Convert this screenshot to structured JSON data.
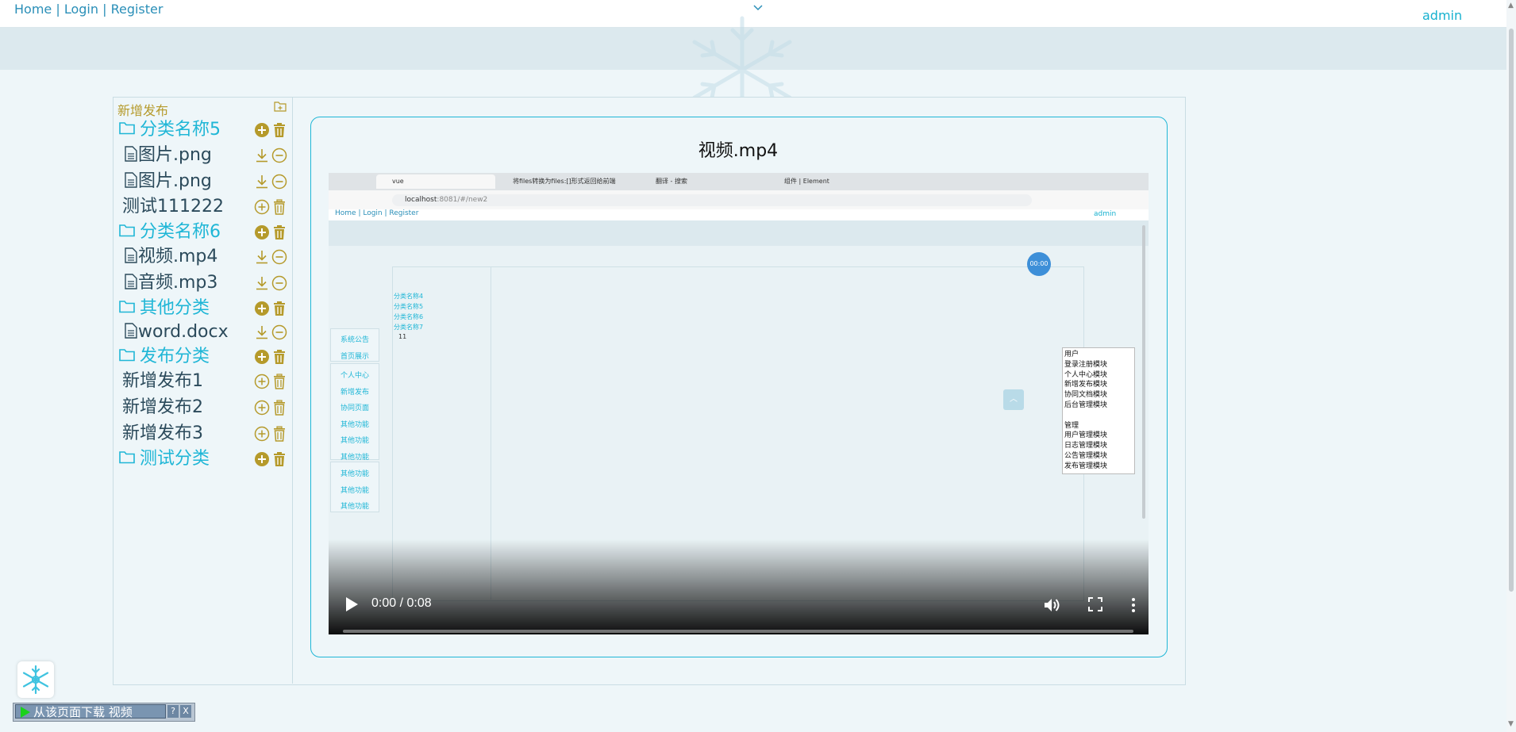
{
  "topbar": {
    "nav": [
      "Home",
      "Login",
      "Register"
    ],
    "user": "admin"
  },
  "sidebar": {
    "header": "新增发布",
    "items": [
      {
        "type": "folder",
        "label": "分类名称5",
        "actions": [
          "add",
          "delete"
        ]
      },
      {
        "type": "file",
        "label": "图片.png",
        "actions": [
          "download",
          "remove"
        ]
      },
      {
        "type": "file",
        "label": "图片.png",
        "actions": [
          "download",
          "remove"
        ]
      },
      {
        "type": "plain",
        "label": "测试111222",
        "actions": [
          "add",
          "delete"
        ]
      },
      {
        "type": "folder",
        "label": "分类名称6",
        "actions": [
          "add",
          "delete"
        ]
      },
      {
        "type": "file",
        "label": "视频.mp4",
        "actions": [
          "download",
          "remove"
        ]
      },
      {
        "type": "file",
        "label": "音频.mp3",
        "actions": [
          "download",
          "remove"
        ]
      },
      {
        "type": "folder",
        "label": "其他分类",
        "actions": [
          "add",
          "delete"
        ]
      },
      {
        "type": "file",
        "label": "word.docx",
        "actions": [
          "download",
          "remove"
        ]
      },
      {
        "type": "folder",
        "label": "发布分类",
        "actions": [
          "add",
          "delete"
        ]
      },
      {
        "type": "plain",
        "label": "新增发布1",
        "actions": [
          "add",
          "delete"
        ]
      },
      {
        "type": "plain",
        "label": "新增发布2",
        "actions": [
          "add",
          "delete"
        ]
      },
      {
        "type": "plain",
        "label": "新增发布3",
        "actions": [
          "add",
          "delete"
        ]
      },
      {
        "type": "folder",
        "label": "测试分类",
        "actions": [
          "add",
          "delete"
        ]
      }
    ]
  },
  "video": {
    "title": "视频.mp4",
    "time": "0:00 / 0:08",
    "progress": 0,
    "frame": {
      "tabs": [
        "vue",
        "将files转换为files:[]形式返回给前端",
        "翻译 - 搜索",
        "组件 | Element"
      ],
      "url_host": "localhost",
      "url_rest": ":8081/#/new2",
      "nav": "Home | Login | Register",
      "user": "admin",
      "timer": "00:00",
      "mini_tree": [
        "分类名称4",
        "分类名称5",
        "分类名称6",
        "分类名称7",
        "11"
      ],
      "left_menu_1": [
        "系统公告",
        "首页展示"
      ],
      "left_menu_2": [
        "个人中心",
        "新增发布",
        "协同页面",
        "其他功能",
        "其他功能",
        "其他功能"
      ],
      "left_menu_3": [
        "其他功能",
        "其他功能",
        "其他功能"
      ],
      "context_menu": [
        "用户",
        "登录注册模块",
        "个人中心模块",
        "新增发布模块",
        "协同文档模块",
        "后台管理模块",
        "",
        "管理",
        "用户管理模块",
        "日志管理模块",
        "公告管理模块",
        "发布管理模块"
      ]
    }
  },
  "download_bar": {
    "label": "从该页面下载 视频",
    "help": "?",
    "close": "X"
  },
  "colors": {
    "accent": "#1fb6d6",
    "gold": "#b59a2b",
    "band": "#dce9ee",
    "page_bg": "#eef6f9"
  }
}
